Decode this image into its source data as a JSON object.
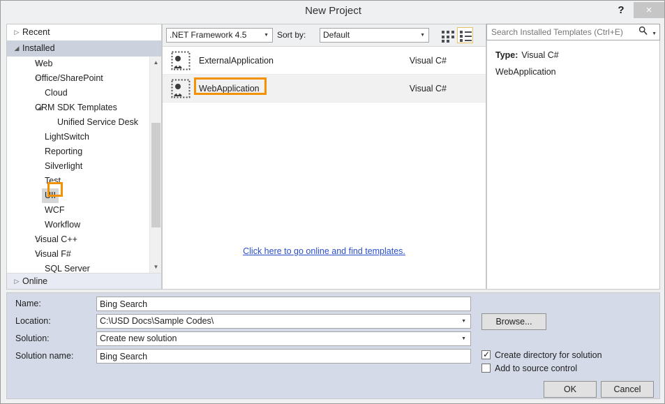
{
  "window": {
    "title": "New Project",
    "help_label": "?",
    "close_label": "×"
  },
  "sidebar": {
    "recent": {
      "label": "Recent",
      "expander": "closed"
    },
    "installed": {
      "label": "Installed",
      "expander": "open"
    },
    "online": {
      "label": "Online",
      "expander": "closed"
    },
    "items": [
      {
        "label": "Web",
        "level": 1,
        "expander": "closed",
        "selected": false
      },
      {
        "label": "Office/SharePoint",
        "level": 1,
        "expander": "closed",
        "selected": false
      },
      {
        "label": "Cloud",
        "level": 1,
        "expander": "none",
        "selected": false
      },
      {
        "label": "CRM SDK Templates",
        "level": 1,
        "expander": "open",
        "selected": false
      },
      {
        "label": "Unified Service Desk",
        "level": 2,
        "expander": "none",
        "selected": false
      },
      {
        "label": "LightSwitch",
        "level": 1,
        "expander": "none",
        "selected": false
      },
      {
        "label": "Reporting",
        "level": 1,
        "expander": "none",
        "selected": false
      },
      {
        "label": "Silverlight",
        "level": 1,
        "expander": "none",
        "selected": false
      },
      {
        "label": "Test",
        "level": 1,
        "expander": "none",
        "selected": false
      },
      {
        "label": "UII",
        "level": 1,
        "expander": "none",
        "selected": true
      },
      {
        "label": "WCF",
        "level": 1,
        "expander": "none",
        "selected": false
      },
      {
        "label": "Workflow",
        "level": 1,
        "expander": "none",
        "selected": false
      },
      {
        "label": "Visual C++",
        "level": 1,
        "expander": "closed",
        "selected": false
      },
      {
        "label": "Visual F#",
        "level": 1,
        "expander": "closed",
        "selected": false
      },
      {
        "label": "SQL Server",
        "level": 1,
        "expander": "none",
        "selected": false
      }
    ]
  },
  "toolbar": {
    "framework": {
      "value": ".NET Framework 4.5",
      "arrow": "▼"
    },
    "sort_by_label": "Sort by:",
    "sort_by": {
      "value": "Default",
      "arrow": "▼"
    },
    "view_medium_icons": "medium-icons-view",
    "view_list": "list-view"
  },
  "templates": {
    "rows": [
      {
        "name": "ExternalApplication",
        "language": "Visual C#",
        "selected": false
      },
      {
        "name": "WebApplication",
        "language": "Visual C#",
        "selected": true
      }
    ],
    "online_link": "Click here to go online and find templates."
  },
  "search": {
    "placeholder": "Search Installed Templates (Ctrl+E)",
    "value": "",
    "icon": "🔍",
    "caret": "▼"
  },
  "info": {
    "type_label": "Type:",
    "type_value": "Visual C#",
    "description": "WebApplication"
  },
  "form": {
    "name_label": "Name:",
    "name_value": "Bing Search",
    "location_label": "Location:",
    "location_value": "C:\\USD Docs\\Sample Codes\\",
    "solution_label": "Solution:",
    "solution_value": "Create new solution",
    "solution_name_label": "Solution name:",
    "solution_name_value": "Bing Search",
    "browse_label": "Browse...",
    "create_directory_label": "Create directory for solution",
    "create_directory_checked": true,
    "add_source_control_label": "Add to source control",
    "add_source_control_checked": false,
    "ok_label": "OK",
    "cancel_label": "Cancel",
    "combo_arrow": "▼"
  },
  "annotations": {
    "color": "#f39200",
    "highlighted": [
      "UII",
      "WebApplication"
    ]
  }
}
